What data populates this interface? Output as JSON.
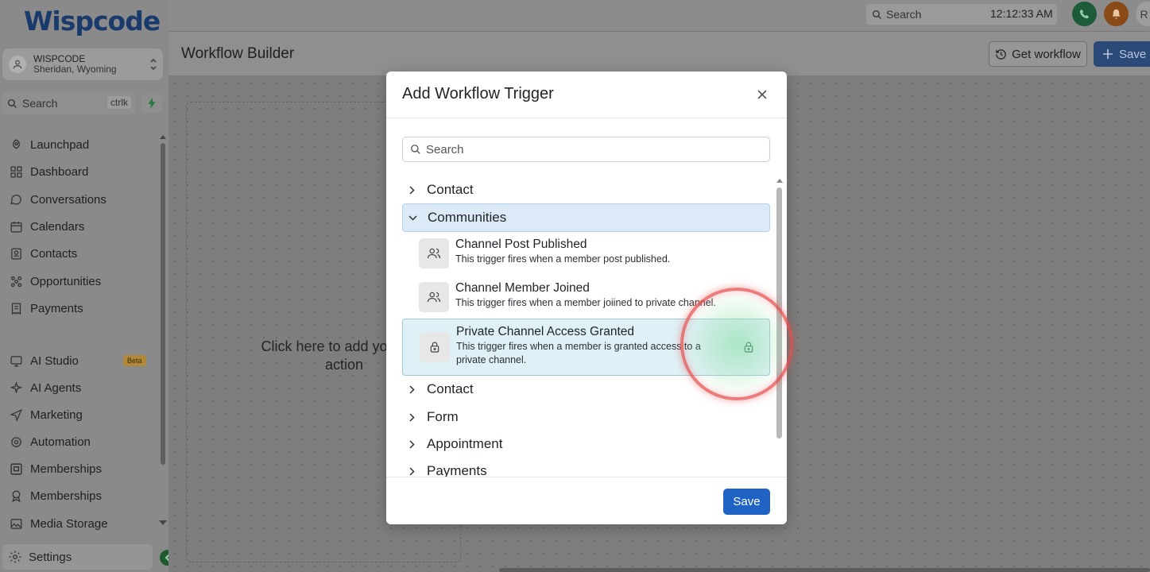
{
  "app": {
    "logo_text": "Wispcode",
    "brand_color": "#1a3a6b"
  },
  "account": {
    "name": "WISPCODE",
    "location": "Sheridan, Wyoming"
  },
  "sidebar_search": {
    "placeholder": "Search",
    "shortcut": "ctrlk"
  },
  "sidebar": {
    "items": [
      {
        "label": "Launchpad",
        "icon": "rocket-icon"
      },
      {
        "label": "Dashboard",
        "icon": "grid-icon"
      },
      {
        "label": "Conversations",
        "icon": "chat-icon"
      },
      {
        "label": "Calendars",
        "icon": "calendar-icon"
      },
      {
        "label": "Contacts",
        "icon": "contact-card-icon"
      },
      {
        "label": "Opportunities",
        "icon": "opportunities-icon"
      },
      {
        "label": "Payments",
        "icon": "receipt-icon"
      },
      {
        "label": "AI Studio",
        "icon": "ai-studio-icon"
      },
      {
        "label": "AI Agents",
        "icon": "sparkle-icon"
      },
      {
        "label": "Marketing",
        "icon": "send-icon"
      },
      {
        "label": "Automation",
        "icon": "automation-icon"
      },
      {
        "label": "Memberships",
        "icon": "membership-card-icon"
      },
      {
        "label": "Memberships",
        "icon": "badge-icon"
      },
      {
        "label": "Media Storage",
        "icon": "image-icon"
      }
    ],
    "beta_label": "Beta",
    "settings_label": "Settings"
  },
  "topbar": {
    "search_placeholder": "Search",
    "clock": "12:12:33 AM",
    "user_initial": "R"
  },
  "page": {
    "title": "Workflow Builder",
    "get_workflow_label": "Get workflow",
    "save_label": "Save",
    "canvas_hint": "Click here to add your first action"
  },
  "modal": {
    "title": "Add Workflow Trigger",
    "search_placeholder": "Search",
    "save_label": "Save",
    "categories_before": [
      {
        "label": "Contact",
        "expanded": false
      },
      {
        "label": "Communities",
        "expanded": true
      }
    ],
    "triggers": [
      {
        "title": "Channel Post Published",
        "desc": "This trigger fires when a member post published.",
        "icon": "users-icon"
      },
      {
        "title": "Channel Member Joined",
        "desc": "This trigger fires when a member joiined to private channel.",
        "icon": "users-icon"
      },
      {
        "title": "Private Channel Access Granted",
        "desc": "This trigger fires when a member is granted access to a private channel.",
        "icon": "lock-icon",
        "selected": true
      }
    ],
    "categories_after": [
      {
        "label": "Contact"
      },
      {
        "label": "Form"
      },
      {
        "label": "Appointment"
      },
      {
        "label": "Payments"
      }
    ]
  },
  "colors": {
    "primary_button": "#1f63c4",
    "selected_row": "#dff1f6",
    "expanded_category": "#dceaf7",
    "highlight_ring": "#e65050"
  }
}
